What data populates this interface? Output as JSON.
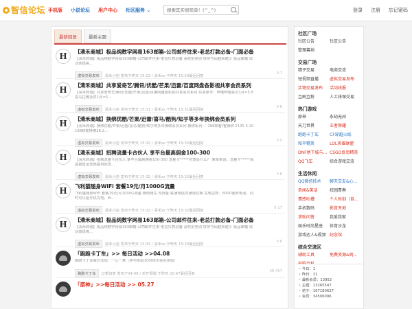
{
  "header": {
    "logo": "智信论坛",
    "nav": [
      "手机版",
      "小说论坛",
      "用户中心",
      "社区服务"
    ],
    "search_placeholder": "搜索其实很简单！(^_^)",
    "user_links": [
      "登录",
      "注册",
      "忘记密码"
    ]
  },
  "tabs": [
    "最新回复",
    "最新主题"
  ],
  "posts": [
    {
      "title": "【清禾商城】极品纯数字网易163邮箱-公司邮件往来-老总打款必备-门面必备",
      "desc": "【清禾商城】极品纯数字网易163邮箱-公司邮件往来-老总打款必备 喜欢别克别 好的号码越来越少 极品邮箱 成功率极高...",
      "badge": "虚拟交易发布",
      "meta": "清禾小店 发布于昨天 15:23 / 清禾xs 于昨天 15:23最后回复",
      "stats": "0  7"
    },
    {
      "title": "【清禾商城】共享爱奇艺/腾讯/优酷/芒果/迅雷/百度网盘各影视共享会员系列",
      "desc": "【清禾商城】共享爱奇艺/腾讯/优酷/芒果/迅雷/百度网盘各影视共享会员系列 共享账号：哔哩哔哩会员1月=5.8 喜马拉雅会员1月=5...",
      "badge": "虚拟交易发布",
      "meta": "清禾小店 发布于昨天 15:31 / 清禾xs 于昨天 15:31最后回复",
      "stats": "0  6"
    },
    {
      "title": "【清禾商城】换绑优酷/芒果/迅雷/喜马/酷狗/知乎等多年换绑会员系列",
      "desc": "【清禾商城】换绑优酷/芒果/迅雷/喜马/酷狗/知乎等多年换绑会员系列 换绑系列：：188映客/客换绑 2135 5.10 188映客换绑26.2...",
      "badge": "虚拟交易发布",
      "meta": "清禾小店 发布于昨天 15:32 / 清禾xs 于昨天 15:32最后回复",
      "stats": "0  5"
    },
    {
      "title": "【清禾商城】招聘流量卡合伙人 享平台最高佣金100-300",
      "desc": "【清禾商城】招聘流量卡合伙人 享平台最高佣金100-300 流量卡*****究竟是什么？ 简单来说，流量卡*****就是销售运营商提供的流...",
      "badge": "虚拟交易发布",
      "meta": "清禾小店 发布于昨天 15:32 / 清禾xs 于昨天 15:32最后回复",
      "stats": "0  8"
    },
    {
      "title": "飞利猫随身WiFi 套餐19元/月1000G流量",
      "desc": "飞利猫随身WiFi 套餐19元/月1000G流量 随用随充 无押金 联通电信双通道切换 充电宝款：8000毫安电池，同时可以给手机充电，W...",
      "badge": "虚拟交易发布",
      "meta": "清禾小店 发布于昨天 15:32 / 清禾xs 于昨天 15:32最后回复",
      "stats": "0  17"
    },
    {
      "title": "【清禾商城】极品纯数字网易163邮箱-公司邮件往来-老总打款必备-门面必备",
      "desc": "【清禾商城】极品纯数字网易163邮箱-公司邮件往来-老总打款必备 喜欢别克别 好的号码越来越少 极品邮箱 成功率极高...",
      "badge": "虚拟交易发布",
      "meta": "清禾小店 发布于昨天 15:33 / 清禾xs 于昨天 15:33最后回复",
      "stats": "0  6"
    },
    {
      "title": "「跑跑卡丁车」>> 每日活动 >>04.08",
      "desc": "跑跑卡丁车每日活动：一心一意（参与奖励1000B币领先奖励）",
      "badge": "跑跑卡丁车",
      "meta": "过季如梦 发布于04-08 / 花开倾城 于昨天 20:47最后回复",
      "stats": "38  417"
    },
    {
      "title": "「原神」>>每日活动 >> 05.27",
      "desc": "",
      "badge": "",
      "meta": "",
      "stats": ""
    }
  ],
  "sidebar": {
    "sections": [
      {
        "title": "社区广场",
        "items": [
          {
            "t": "社区公告",
            "c": ""
          },
          {
            "t": "社区公告",
            "c": ""
          },
          {
            "t": "管理幕地",
            "c": ""
          }
        ]
      },
      {
        "title": "交易广场",
        "items": [
          {
            "t": "精子交易",
            "c": ""
          },
          {
            "t": "电商交流",
            "c": ""
          },
          {
            "t": "短视频直播",
            "c": ""
          },
          {
            "t": "虚拟交易发布",
            "c": "r"
          },
          {
            "t": "实物交易发布",
            "c": "r"
          },
          {
            "t": "活动线报",
            "c": "r"
          },
          {
            "t": "互刷互粉",
            "c": ""
          },
          {
            "t": "人工排保交易",
            "c": ""
          }
        ]
      },
      {
        "title": "热门游戏",
        "items": [
          {
            "t": "原神",
            "c": ""
          },
          {
            "t": "永劫无间",
            "c": ""
          },
          {
            "t": "天刀世界",
            "c": ""
          },
          {
            "t": "王者荣耀",
            "c": "r"
          },
          {
            "t": "跑跑卡丁车",
            "c": "b"
          },
          {
            "t": "CF穿越火线",
            "c": "b"
          },
          {
            "t": "和平精英",
            "c": "b"
          },
          {
            "t": "LOL英雄联盟",
            "c": "r"
          },
          {
            "t": "DNF地下城与...",
            "c": "r"
          },
          {
            "t": "CSGO反恐精英",
            "c": "r"
          },
          {
            "t": "QQ飞车",
            "c": "r"
          },
          {
            "t": "综合游戏交流",
            "c": ""
          }
        ]
      },
      {
        "title": "生活休闲",
        "items": [
          {
            "t": "QQ微信技术",
            "c": "b"
          },
          {
            "t": "聊天交友&心...",
            "c": "b"
          },
          {
            "t": "奇闻&笑话",
            "c": "r"
          },
          {
            "t": "校园青春",
            "c": ""
          },
          {
            "t": "情感吐槽",
            "c": "r"
          },
          {
            "t": "个人时刻（自...",
            "c": "r"
          },
          {
            "t": "手机数码",
            "c": ""
          },
          {
            "t": "影音天地",
            "c": "r"
          },
          {
            "t": "求助问答",
            "c": "r"
          },
          {
            "t": "我爱我家",
            "c": ""
          },
          {
            "t": "娱乐时尚星座",
            "c": ""
          },
          {
            "t": "体育沙龙",
            "c": ""
          },
          {
            "t": "游戏达人&视频",
            "c": ""
          },
          {
            "t": "纪念馆",
            "c": "r"
          }
        ]
      },
      {
        "title": "综合交流区",
        "items": [
          {
            "t": "辅助工具",
            "c": "r"
          },
          {
            "t": "免费资源&网...",
            "c": "r"
          },
          {
            "t": "电脑百科",
            "c": "r"
          }
        ]
      }
    ],
    "stats": [
      "今日：1",
      "昨日：31",
      "最新会员：13952",
      "主题：13265547",
      "帖子：167180627",
      "会员：34506096"
    ]
  }
}
